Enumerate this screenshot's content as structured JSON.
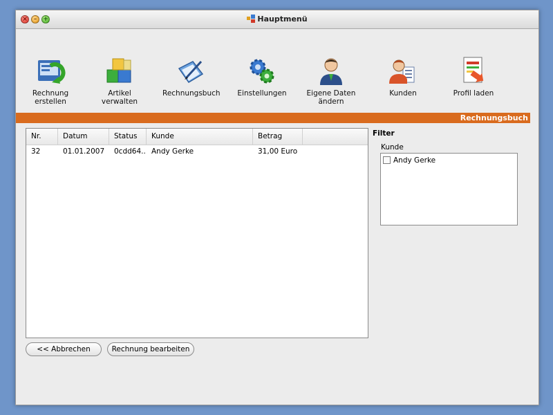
{
  "window": {
    "title": "Hauptmenü"
  },
  "toolbar": {
    "items": [
      {
        "label": "Rechnung erstellen",
        "icon": "invoice-create-icon"
      },
      {
        "label": "Artikel verwalten",
        "icon": "boxes-icon"
      },
      {
        "label": "Rechnungsbuch",
        "icon": "book-pen-icon"
      },
      {
        "label": "Einstellungen",
        "icon": "gears-icon"
      },
      {
        "label": "Eigene Daten ändern",
        "icon": "user-suit-icon"
      },
      {
        "label": "Kunden",
        "icon": "customer-card-icon"
      },
      {
        "label": "Profil laden",
        "icon": "document-arrow-icon"
      }
    ]
  },
  "section": {
    "title": "Rechnungsbuch",
    "accent": "#d96b1e"
  },
  "table": {
    "columns": [
      "Nr.",
      "Datum",
      "Status",
      "Kunde",
      "Betrag"
    ],
    "rows": [
      [
        "32",
        "01.01.2007",
        "0cdd64...",
        "Andy Gerke",
        "31,00 Euro"
      ]
    ]
  },
  "filter": {
    "title": "Filter",
    "kunde_label": "Kunde",
    "options": [
      {
        "label": "Andy Gerke",
        "checked": false
      }
    ]
  },
  "buttons": {
    "cancel": "<< Abbrechen",
    "edit": "Rechnung bearbeiten"
  }
}
